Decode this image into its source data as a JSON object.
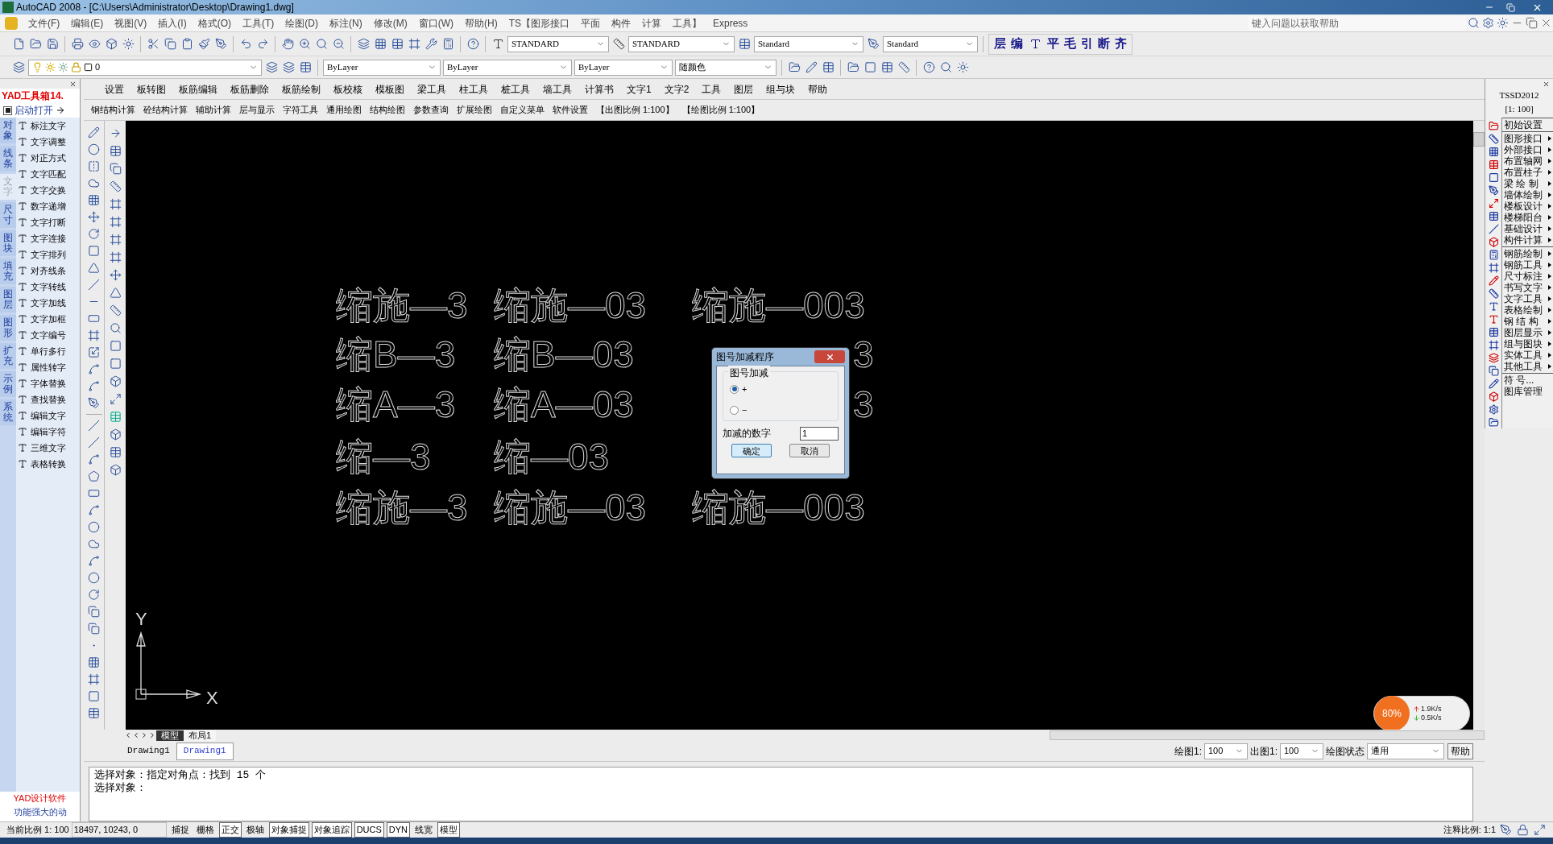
{
  "window": {
    "title": "AutoCAD 2008 - [C:\\Users\\Administrator\\Desktop\\Drawing1.dwg]"
  },
  "menu_bar": [
    "文件(F)",
    "编辑(E)",
    "视图(V)",
    "插入(I)",
    "格式(O)",
    "工具(T)",
    "绘图(D)",
    "标注(N)",
    "修改(M)",
    "窗口(W)",
    "帮助(H)",
    "TS【图形接口",
    "平面",
    "构件",
    "计算",
    "工具】",
    "Express"
  ],
  "help_search": {
    "placeholder": "键入问题以获取帮助"
  },
  "style_boxes": [
    "STANDARD",
    "STANDARD",
    "Standard",
    "Standard"
  ],
  "tssd_quick_buttons": [
    "层",
    "编",
    "平",
    "毛",
    "引",
    "断",
    "齐"
  ],
  "layer_bar": {
    "layer": "0",
    "color_control": "ByLayer",
    "linetype": "ByLayer",
    "lineweight": "ByLayer",
    "plot_style": "随颜色"
  },
  "tssd_menu_1": [
    "设置",
    "板转图",
    "板筋编辑",
    "板筋删除",
    "板筋绘制",
    "板校核",
    "模板图",
    "梁工具",
    "柱工具",
    "桩工具",
    "墙工具",
    "计算书",
    "文字1",
    "文字2",
    "工具",
    "图层",
    "组与块",
    "帮助"
  ],
  "tssd_menu_2": [
    "钢结构计算",
    "砼结构计算",
    "辅助计算",
    "层与显示",
    "字符工具",
    "通用绘图",
    "结构绘图",
    "参数查询",
    "扩展绘图",
    "自定义菜单",
    "软件设置",
    "【出图比例 1:100】",
    "【绘图比例 1:100】"
  ],
  "yad_panel": {
    "title": "YAD工具箱14.",
    "autostart": {
      "label": "启动打开",
      "checked": true
    },
    "categories": [
      {
        "label": "对象",
        "selected": false
      },
      {
        "label": "线条",
        "selected": false
      },
      {
        "label": "文字",
        "selected": true
      },
      {
        "label": "尺寸",
        "selected": false
      },
      {
        "label": "图块",
        "selected": false
      },
      {
        "label": "填充",
        "selected": false
      },
      {
        "label": "图层",
        "selected": false
      },
      {
        "label": "图形",
        "selected": false
      },
      {
        "label": "扩充",
        "selected": false
      },
      {
        "label": "示例",
        "selected": false
      },
      {
        "label": "系统",
        "selected": false
      }
    ],
    "items": [
      "标注文字",
      "文字调整",
      "对正方式",
      "文字匹配",
      "文字交换",
      "数字递增",
      "文字打断",
      "文字连接",
      "文字排列",
      "对齐线条",
      "文字转线",
      "文字加线",
      "文字加框",
      "文字编号",
      "单行多行",
      "属性转字",
      "字体替换",
      "查找替换",
      "编辑文字",
      "编辑字符",
      "三维文字",
      "表格转换"
    ],
    "footer_title": "YAD设计软件",
    "footer_slogan": "功能强大的动"
  },
  "canvas": {
    "rows": [
      {
        "cells": [
          "缩施—3",
          "缩施—03",
          "缩施—003"
        ]
      },
      {
        "cells": [
          "缩B—3",
          "缩B—03"
        ],
        "tail": "3"
      },
      {
        "cells": [
          "缩A—3",
          "缩A—03"
        ],
        "tail": "3"
      },
      {
        "cells": [
          "缩—3",
          "缩—03"
        ]
      },
      {
        "cells": [
          "缩施—3",
          "缩施—03",
          "缩施—003"
        ]
      }
    ],
    "axis_x": "X",
    "axis_y": "Y"
  },
  "dialog": {
    "title": "图号加减程序",
    "group": "图号加减",
    "options": [
      {
        "label": "+",
        "selected": true
      },
      {
        "label": "−",
        "selected": false
      }
    ],
    "field_label": "加减的数字",
    "field_value": "1",
    "buttons": [
      "确定",
      "取消"
    ]
  },
  "tssd_panel": {
    "title": "TSSD2012",
    "scale": "[1: 100]",
    "groups": [
      [
        {
          "label": "初始设置",
          "submenu": false
        }
      ],
      [
        {
          "label": "图形接口",
          "submenu": true
        },
        {
          "label": "外部接口",
          "submenu": true
        },
        {
          "label": "布置轴网",
          "submenu": true
        },
        {
          "label": "布置柱子",
          "submenu": true
        },
        {
          "label": "梁 绘 制",
          "submenu": true
        },
        {
          "label": "墙体绘制",
          "submenu": true
        },
        {
          "label": "楼板设计",
          "submenu": true
        },
        {
          "label": "楼梯阳台",
          "submenu": true
        },
        {
          "label": "基础设计",
          "submenu": true
        },
        {
          "label": "构件计算",
          "submenu": true
        }
      ],
      [
        {
          "label": "钢筋绘制",
          "submenu": true
        },
        {
          "label": "钢筋工具",
          "submenu": true
        },
        {
          "label": "尺寸标注",
          "submenu": true
        },
        {
          "label": "书写文字",
          "submenu": true
        },
        {
          "label": "文字工具",
          "submenu": true
        },
        {
          "label": "表格绘制",
          "submenu": true
        },
        {
          "label": "钢 结 构",
          "submenu": true
        },
        {
          "label": "图层显示",
          "submenu": true
        },
        {
          "label": "组与图块",
          "submenu": true
        },
        {
          "label": "实体工具",
          "submenu": true
        },
        {
          "label": "其他工具",
          "submenu": true
        }
      ],
      [
        {
          "label": "符 号...",
          "submenu": false
        },
        {
          "label": "图库管理",
          "submenu": false
        }
      ]
    ]
  },
  "net_widget": {
    "percent": "80%",
    "up": "1.9K/s",
    "down": "0.5K/s"
  },
  "layout_tabs": [
    {
      "label": "模型",
      "selected": true
    },
    {
      "label": "布局1",
      "selected": false
    }
  ],
  "doc_tabs": [
    {
      "label": "Drawing1",
      "selected": false
    },
    {
      "label": "Drawing1",
      "selected": true
    }
  ],
  "scale_bar": {
    "draw_label": "绘图1:",
    "draw_value": "100",
    "plot_label": "出图1:",
    "plot_value": "100",
    "state_label": "绘图状态",
    "state_value": "通用",
    "help": "帮助"
  },
  "command_lines": [
    "选择对象：指定对角点：找到 15 个",
    "选择对象："
  ],
  "status_bar": {
    "scale": "当前比例 1: 100",
    "coords": "18497, 10243, 0",
    "toggles": [
      {
        "label": "捕捉",
        "on": false
      },
      {
        "label": "栅格",
        "on": false
      },
      {
        "label": "正交",
        "on": true
      },
      {
        "label": "极轴",
        "on": false
      },
      {
        "label": "对象捕捉",
        "on": true
      },
      {
        "label": "对象追踪",
        "on": true
      },
      {
        "label": "DUCS",
        "on": true
      },
      {
        "label": "DYN",
        "on": true
      },
      {
        "label": "线宽",
        "on": false
      },
      {
        "label": "模型",
        "on": true
      }
    ],
    "annotation_label": "注释比例:",
    "annotation_value": "1:1"
  }
}
